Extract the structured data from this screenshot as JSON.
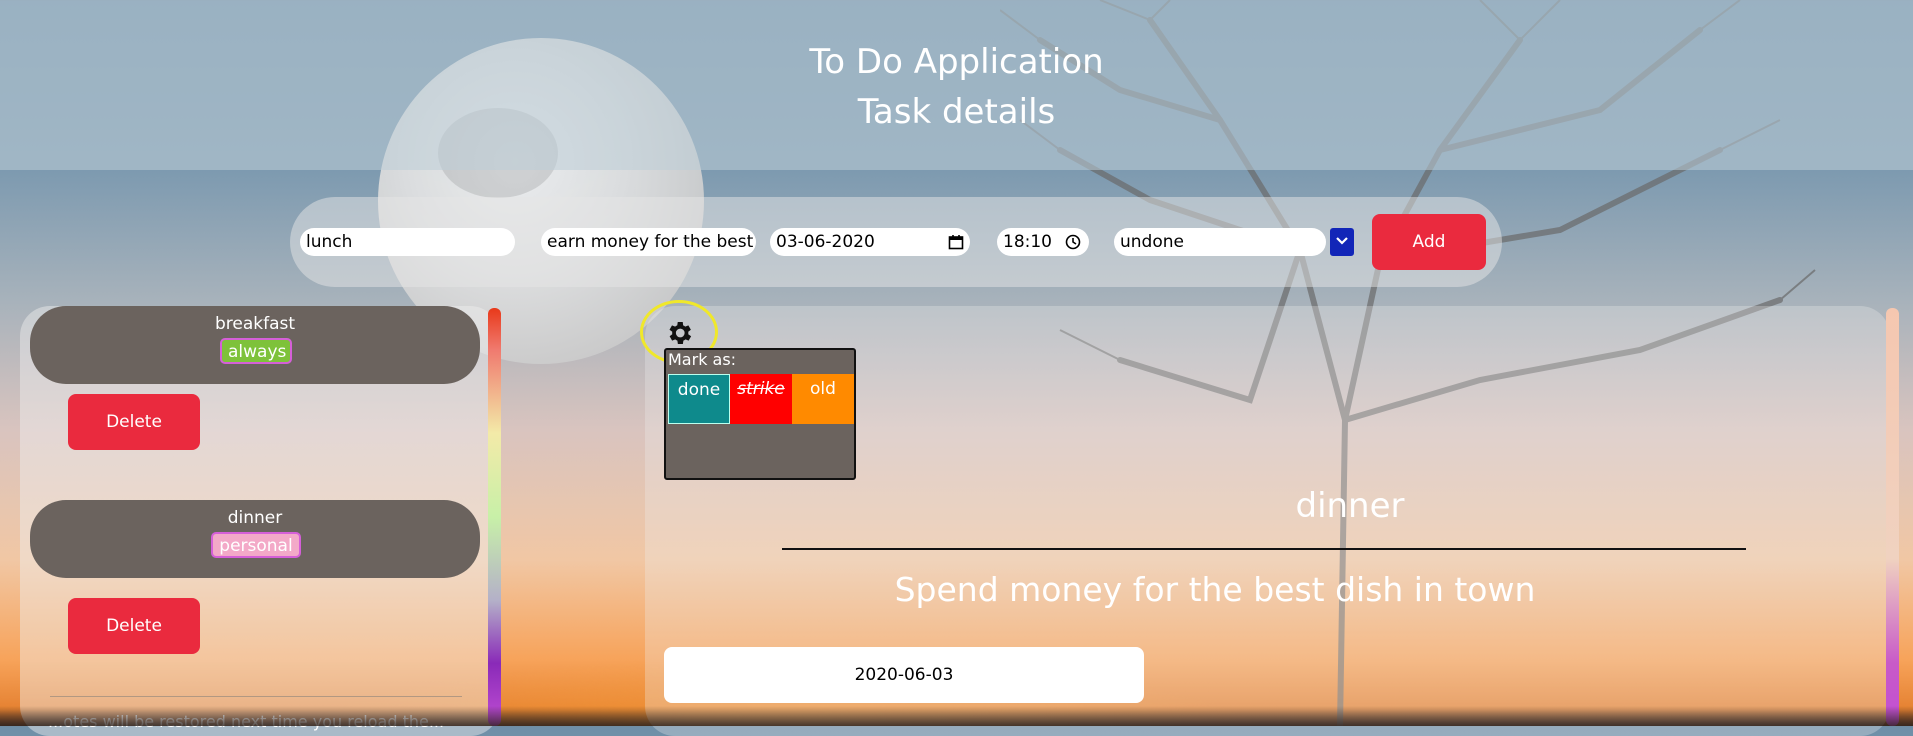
{
  "header": {
    "title": "To Do Application",
    "subtitle": "Task details"
  },
  "form": {
    "name_value": "lunch",
    "description_value": "earn money for the best",
    "date_value": "03-06-2020",
    "time_value": "18:10",
    "status_value": "undone",
    "add_label": "Add"
  },
  "task_list": {
    "items": [
      {
        "name": "breakfast",
        "tag": "always",
        "delete_label": "Delete"
      },
      {
        "name": "dinner",
        "tag": "personal",
        "delete_label": "Delete"
      }
    ],
    "footer_note": "...otes will be restored next time you reload the..."
  },
  "detail": {
    "mark_as_label": "Mark as:",
    "options": [
      "done",
      "strike",
      "old"
    ],
    "title": "dinner",
    "description": "Spend money for the best dish in town",
    "date": "2020-06-03"
  },
  "colors": {
    "accent_red": "#ea2a3e",
    "tag_always": "#7ec23a",
    "tag_personal": "#f3a9c8",
    "opt_done": "#0e8a8c",
    "opt_strike": "#ff0000",
    "opt_old": "#ff8a00"
  },
  "icons": [
    "calendar-icon",
    "clock-icon",
    "chevron-down-icon",
    "gear-icon"
  ]
}
